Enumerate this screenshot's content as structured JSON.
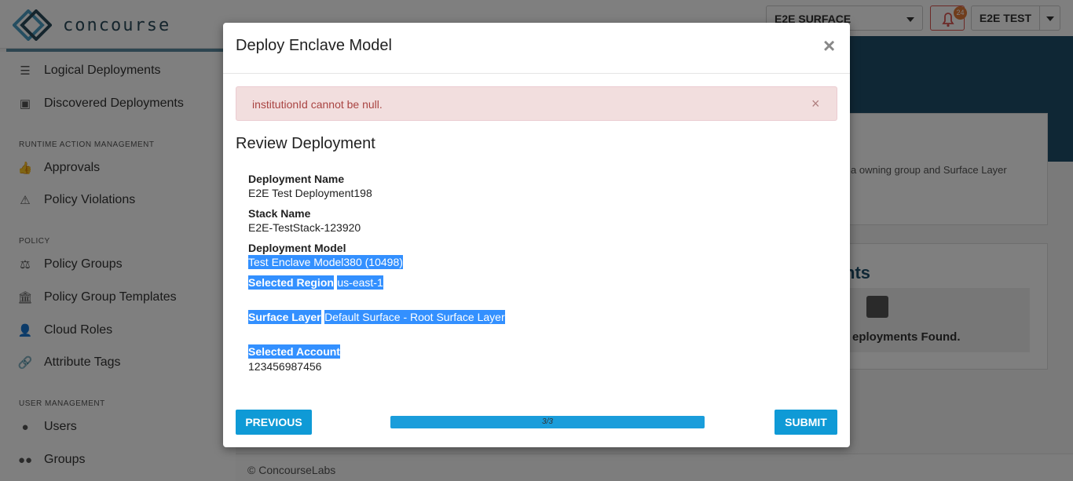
{
  "app": {
    "logo_text": "concourse",
    "tenant": "E2E SURFACE",
    "notification_count": "24",
    "user": "E2E TEST"
  },
  "sidebar": {
    "items_top": [
      {
        "label": "Logical Deployments",
        "icon": "list-icon"
      },
      {
        "label": "Discovered Deployments",
        "icon": "discover-icon"
      }
    ],
    "section_runtime": "RUNTIME ACTION MANAGEMENT",
    "items_runtime": [
      {
        "label": "Approvals",
        "icon": "thumbs-up-icon"
      },
      {
        "label": "Policy Violations",
        "icon": "warning-icon"
      }
    ],
    "section_policy": "POLICY",
    "items_policy": [
      {
        "label": "Policy Groups",
        "icon": "scale-icon"
      },
      {
        "label": "Policy Group Templates",
        "icon": "bank-icon"
      },
      {
        "label": "Cloud Roles",
        "icon": "user-lock-icon"
      },
      {
        "label": "Attribute Tags",
        "icon": "link-icon"
      }
    ],
    "section_user": "USER MANAGEMENT",
    "items_user": [
      {
        "label": "Users",
        "icon": "user-icon"
      },
      {
        "label": "Groups",
        "icon": "users-icon"
      }
    ]
  },
  "background": {
    "card1_text": "a owning group and Surface Layer",
    "card2_title": "nts",
    "card2_empty": "eployments Found."
  },
  "footer": "© ConcourseLabs",
  "modal": {
    "title": "Deploy Enclave Model",
    "close": "×",
    "alert": {
      "text": "institutionId cannot be null.",
      "close": "×"
    },
    "section_title": "Review Deployment",
    "fields": [
      {
        "label": "Deployment Name",
        "value": "E2E Test Deployment198"
      },
      {
        "label": "Stack Name",
        "value": "E2E-TestStack-123920"
      },
      {
        "label": "Deployment Model",
        "value": "Test Enclave Model380 (10498)"
      },
      {
        "label": "Selected Region",
        "value": "us-east-1"
      },
      {
        "label": "Surface Layer",
        "value": "Default Surface - Root Surface Layer"
      },
      {
        "label": "Selected Account",
        "value": "123456987456"
      }
    ],
    "previous_label": "PREVIOUS",
    "submit_label": "SUBMIT",
    "progress": {
      "text": "3/3",
      "fraction": 1.0
    }
  },
  "colors": {
    "accent": "#0f9ad6",
    "navy": "#1f4e6b",
    "alert_bg": "#f2dede",
    "alert_text": "#a94442",
    "selection": "#3390ff"
  }
}
